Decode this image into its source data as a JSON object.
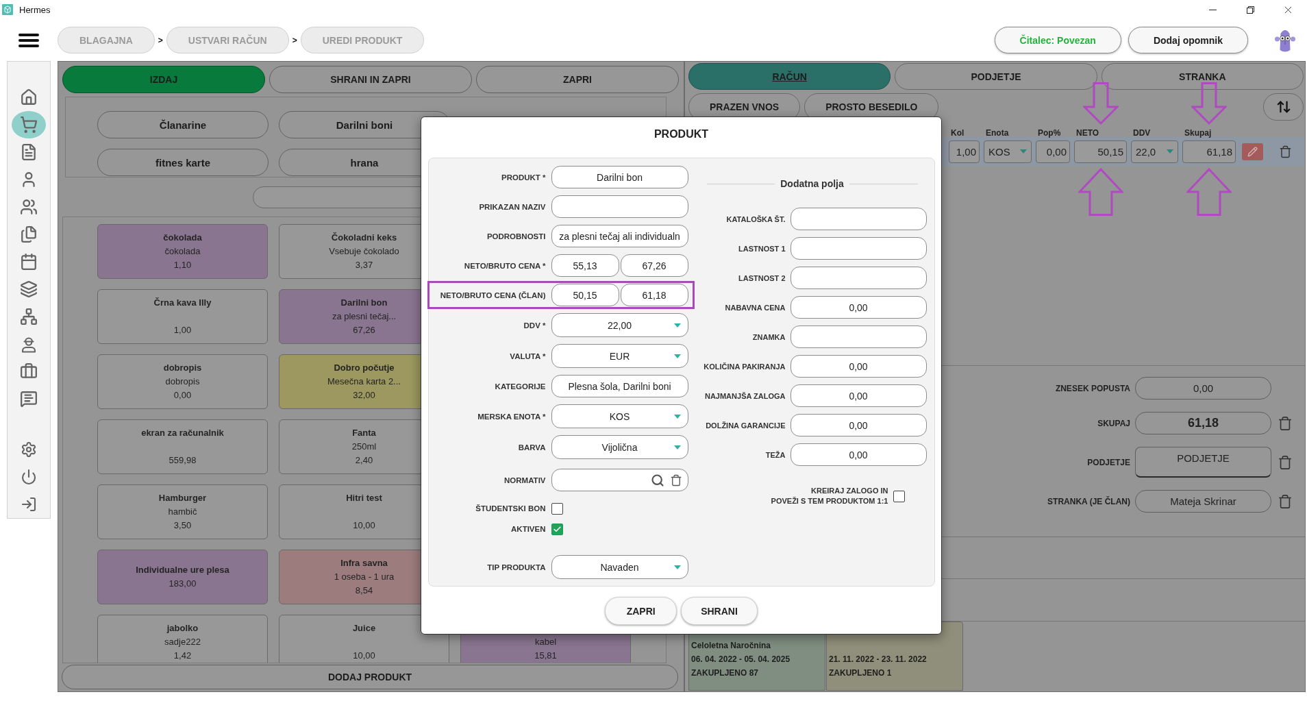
{
  "window": {
    "title": "Hermes"
  },
  "breadcrumbs": [
    {
      "label": "BLAGAJNA",
      "separator": ">"
    },
    {
      "label": "USTVARI RAČUN",
      "separator": ">"
    },
    {
      "label": "UREDI PRODUKT"
    }
  ],
  "header_actions": [
    {
      "label": "Čitalec: Povezan",
      "kind": "status"
    },
    {
      "label": "Dodaj opomnik",
      "kind": "action"
    }
  ],
  "sidebar": {
    "items": [
      {
        "selected": false
      },
      {
        "selected": true
      },
      {
        "selected": false
      },
      {
        "selected": false
      },
      {
        "selected": false
      },
      {
        "selected": false
      },
      {
        "selected": false
      },
      {
        "selected": false
      },
      {
        "selected": false
      },
      {
        "selected": false
      },
      {
        "selected": false
      },
      {
        "selected": false
      }
    ],
    "footer_items": [
      {
        "selected": false
      },
      {
        "selected": false
      },
      {
        "selected": false
      }
    ]
  },
  "actions": [
    {
      "label": "IZDAJ",
      "kind": "primary"
    },
    {
      "label": "SHRANI IN ZAPRI",
      "kind": "secondary"
    },
    {
      "label": "ZAPRI",
      "kind": "secondary"
    }
  ],
  "categories": {
    "rows": [
      [
        "Članarine",
        "Darilni boni"
      ],
      [
        "fitnes karte",
        "hrana"
      ]
    ]
  },
  "products": {
    "rows": [
      [
        {
          "name": "čokolada",
          "description": "čokolada",
          "price": "1,10",
          "color": "#8a7590",
          "kind": "stacked"
        },
        {
          "name": "Čokoladni keks",
          "description": "Vsebuje čokolado",
          "price": "3,37",
          "color": "#989898",
          "kind": "stacked"
        }
      ],
      [
        {
          "name": "Črna kava Illy",
          "price": "1,00",
          "color": "#989898",
          "kind": "stacked"
        },
        {
          "name": "Darilni bon",
          "description": "za plesni tečaj...",
          "price": "67,26",
          "color": "#8a7590",
          "kind": "stacked"
        }
      ],
      [
        {
          "name": "dobropis",
          "description": "dobropis",
          "price": "0,00",
          "color": "#989898",
          "kind": "stacked"
        },
        {
          "name": "Dobro počutje",
          "description": "Mesečna karta 2...",
          "price": "32,00",
          "color": "#9c985f",
          "kind": "stacked"
        }
      ],
      [
        {
          "name": "ekran za računalnik",
          "price": "559,98",
          "color": "#989898",
          "kind": "stacked"
        },
        {
          "name": "Fanta",
          "description": "250ml",
          "price": "2,40",
          "color": "#989898",
          "kind": "stacked"
        }
      ],
      [
        {
          "name": "Hamburger",
          "description": "hambič",
          "price": "3,50",
          "color": "#989898",
          "kind": "stacked"
        },
        {
          "name": "Hitri test",
          "price": "10,00",
          "color": "#989898",
          "kind": "stacked"
        }
      ],
      [
        {
          "name": "Individualne ure plesa",
          "price": "183,00",
          "color": "#8a7590",
          "kind": "centered"
        },
        {
          "name": "Infra savna",
          "description": "1 oseba - 1 ura",
          "price": "8,54",
          "color": "#9c7c7d",
          "kind": "stacked"
        }
      ],
      [
        {
          "name": "jabolko",
          "description": "sadje222",
          "price": "1,42",
          "color": "#989898",
          "kind": "stacked"
        },
        {
          "name": "Juice",
          "price": "10,00",
          "color": "#989898",
          "kind": "stacked"
        },
        {
          "description": "kabel",
          "price": "15,81",
          "color": "#8a7590",
          "kind": "stacked"
        }
      ]
    ],
    "add_button": "DODAJ PRODUKT"
  },
  "invoice": {
    "tabs": [
      {
        "label": "RAČUN",
        "selected": true
      },
      {
        "label": "PODJETJE",
        "selected": false
      },
      {
        "label": "STRANKA",
        "selected": false
      }
    ],
    "entry_buttons": [
      "PRAZEN VNOS",
      "PROSTO BESEDILO"
    ],
    "columns": [
      {
        "label": "Kol",
        "marked": false
      },
      {
        "label": "Enota",
        "marked": false
      },
      {
        "label": "Pop%",
        "marked": false
      },
      {
        "label": "NETO",
        "marked": true
      },
      {
        "label": "DDV",
        "marked": false
      },
      {
        "label": "Skupaj",
        "marked": true
      }
    ],
    "rows": [
      {
        "selected": true,
        "cells": [
          {
            "kind": "number",
            "value": "1,00"
          },
          {
            "kind": "select",
            "value": "KOS"
          },
          {
            "kind": "number",
            "value": "0,00"
          },
          {
            "kind": "number",
            "value": "50,15"
          },
          {
            "kind": "select",
            "value": "22,0"
          },
          {
            "kind": "number",
            "value": "61,18"
          }
        ]
      }
    ],
    "summary": [
      {
        "label": "ZNESEK POPUSTA",
        "value": "0,00",
        "kind": "field",
        "removable": false
      },
      {
        "label": "SKUPAJ",
        "value": "61,18",
        "kind": "total",
        "removable": true
      },
      {
        "label": "PODJETJE",
        "value": "PODJETJE",
        "kind": "picker",
        "removable": true
      },
      {
        "label": "STRANKA (JE ČLAN)",
        "value": "Mateja Skrinar",
        "kind": "field",
        "removable": true
      }
    ],
    "subscriptions": [
      {
        "title": "Celoletna Naročnina",
        "period": "06. 04. 2022 - 05. 04. 2025",
        "usage": "ZAKUPLJENO 87",
        "color": "#7f8e80"
      },
      {
        "period": "21. 11. 2022 - 23. 11. 2022",
        "usage": "ZAKUPLJENO 1",
        "color": "#908f7b"
      }
    ]
  },
  "dialog": {
    "title": "PRODUKT",
    "fields": [
      {
        "label": "PRODUKT *",
        "kind": "text",
        "value": "Darilni bon",
        "highlighted": false
      },
      {
        "label": "PRIKAZAN NAZIV",
        "kind": "text",
        "highlighted": false
      },
      {
        "label": "PODROBNOSTI",
        "kind": "text",
        "value": "za plesni tečaj ali individualn",
        "highlighted": false
      },
      {
        "label": "NETO/BRUTO CENA *",
        "kind": "pair",
        "values": [
          "55,13",
          "67,26"
        ],
        "highlighted": false
      },
      {
        "label": "NETO/BRUTO CENA (ČLAN)",
        "kind": "pair",
        "values": [
          "50,15",
          "61,18"
        ],
        "highlighted": true
      },
      {
        "label": "DDV *",
        "kind": "select",
        "value": "22,00",
        "highlighted": false
      },
      {
        "label": "VALUTA *",
        "kind": "select",
        "value": "EUR",
        "highlighted": false
      },
      {
        "label": "KATEGORIJE",
        "kind": "text",
        "value": "Plesna šola, Darilni boni",
        "highlighted": false
      },
      {
        "label": "MERSKA ENOTA *",
        "kind": "select",
        "value": "KOS",
        "highlighted": false
      },
      {
        "label": "BARVA",
        "kind": "select",
        "value": "Vijolična",
        "highlighted": false
      },
      {
        "label": "NORMATIV",
        "kind": "lookup",
        "highlighted": false
      },
      {
        "label": "ŠTUDENTSKI BON",
        "kind": "checkbox",
        "checked": false,
        "highlighted": false
      },
      {
        "label": "AKTIVEN",
        "kind": "checkbox",
        "checked": true,
        "highlighted": false
      },
      {
        "label": "TIP PRODUKTA",
        "kind": "select",
        "value": "Navaden",
        "highlighted": false
      }
    ],
    "extra_title": "Dodatna polja",
    "extra_fields": [
      {
        "label": "KATALOŠKA ŠT."
      },
      {
        "label": "LASTNOST 1"
      },
      {
        "label": "LASTNOST 2"
      },
      {
        "label": "NABAVNA CENA",
        "value": "0,00"
      },
      {
        "label": "ZNAMKA"
      },
      {
        "label": "KOLIČINA PAKIRANJA",
        "value": "0,00"
      },
      {
        "label": "NAJMANJŠA ZALOGA",
        "value": "0,00"
      },
      {
        "label": "DOLŽINA GARANCIJE",
        "value": "0,00"
      },
      {
        "label": "TEŽA",
        "value": "0,00"
      }
    ],
    "stock_link": {
      "label": "KREIRAJ ZALOGO IN\nPOVEŽI S TEM PRODUKTOM 1:1",
      "checked": false
    },
    "buttons": [
      "ZAPRI",
      "SHRANI"
    ]
  }
}
